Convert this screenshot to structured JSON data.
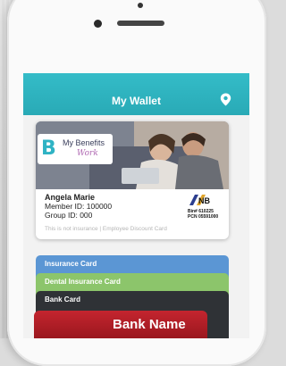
{
  "app": {
    "title": "My Wallet",
    "header_color": "#2fb3c0"
  },
  "header_icons": {
    "location": "location-pin-icon"
  },
  "benefits_card": {
    "logo_line1": "My Benefits",
    "logo_line2": "Work",
    "member_name": "Angela Marie",
    "member_id": "Member ID: 100000",
    "group_id": "Group ID: 000",
    "bin": "Bin# 610225",
    "pcn": "PCN 05591000",
    "disclaimer": "This is not insurance | Employee Discount Card"
  },
  "stacked_cards": [
    {
      "label": "Insurance Card",
      "color": "#5b96d4"
    },
    {
      "label": "Dental Insurance Card",
      "color": "#8cc56b"
    },
    {
      "label": "Bank Card",
      "color": "#2f3236"
    }
  ],
  "bank_card": {
    "name": "Bank Name",
    "color": "#c4252f"
  }
}
